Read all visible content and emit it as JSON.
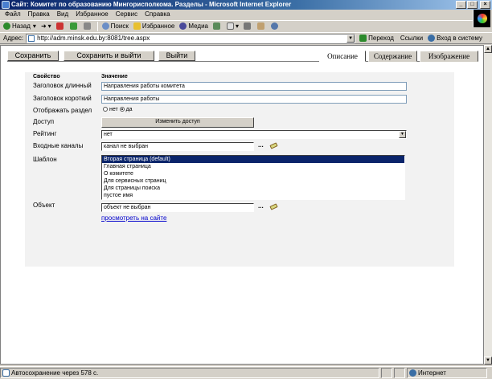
{
  "window": {
    "title": "Сайт: Комитет по образованию Мингорисполкома. Разделы - Microsoft Internet Explorer"
  },
  "menu": [
    "Файл",
    "Правка",
    "Вид",
    "Избранное",
    "Сервис",
    "Справка"
  ],
  "toolbar": {
    "back": "Назад",
    "search": "Поиск",
    "favorites": "Избранное",
    "media": "Медиа"
  },
  "address": {
    "label": "Адрес:",
    "url": "http://adm.minsk.edu.by:8081/tree.aspx",
    "go": "Переход",
    "links": "Ссылки",
    "login": "Вход в систему"
  },
  "actions": {
    "save": "Сохранить",
    "save_exit": "Сохранить и выйти",
    "exit": "Выйти"
  },
  "tabs": [
    "Описание",
    "Содержание",
    "Изображение"
  ],
  "form": {
    "header_property": "Свойство",
    "header_value": "Значение",
    "long_title_label": "Заголовок длинный",
    "long_title_value": "Направления работы комитета",
    "short_title_label": "Заголовок короткий",
    "short_title_value": "Направления работы",
    "show_section_label": "Отображать раздел",
    "radio_no": "нет",
    "radio_yes": "да",
    "access_label": "Доступ",
    "access_button": "Изменить доступ",
    "rating_label": "Рейтинг",
    "rating_value": "нет",
    "channels_label": "Входные каналы",
    "channels_value": "канал не выбран",
    "template_label": "Шаблон",
    "template_options": [
      "Вторая страница (default)",
      "Главная страница",
      "О комитете",
      "Для сервисных страниц",
      "Для страницы поиска",
      "пустое имя"
    ],
    "object_label": "Объект",
    "object_value": "объект не выбран",
    "view_link": "просмотреть на сайте",
    "dots": "..."
  },
  "status": {
    "autosave": "Автосохранение через 578 с.",
    "zone": "Интернет"
  }
}
